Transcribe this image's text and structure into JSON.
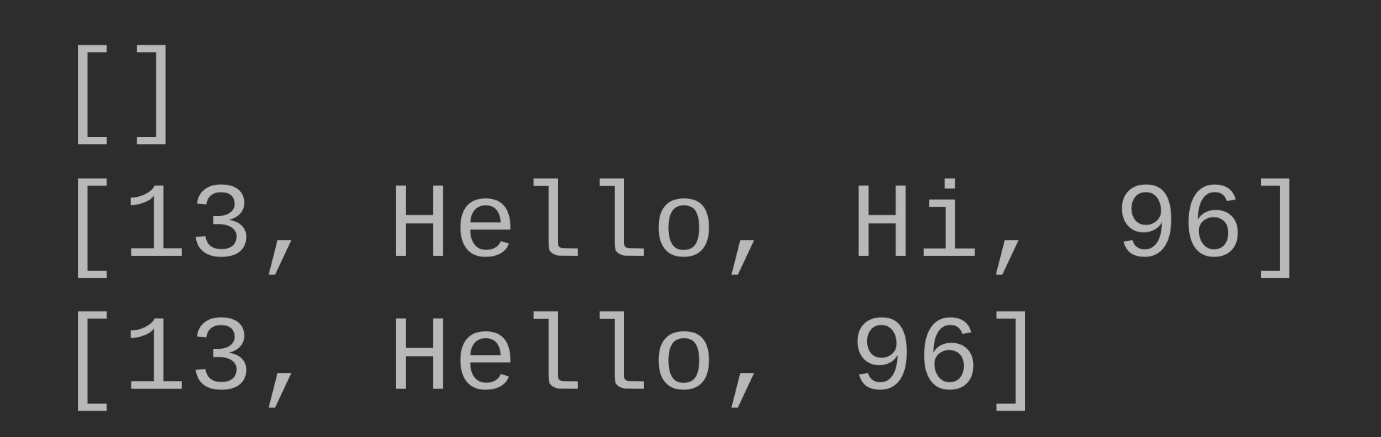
{
  "output": {
    "lines": [
      "[]",
      "[13, Hello, Hi, 96]",
      "[13, Hello, 96]"
    ]
  }
}
